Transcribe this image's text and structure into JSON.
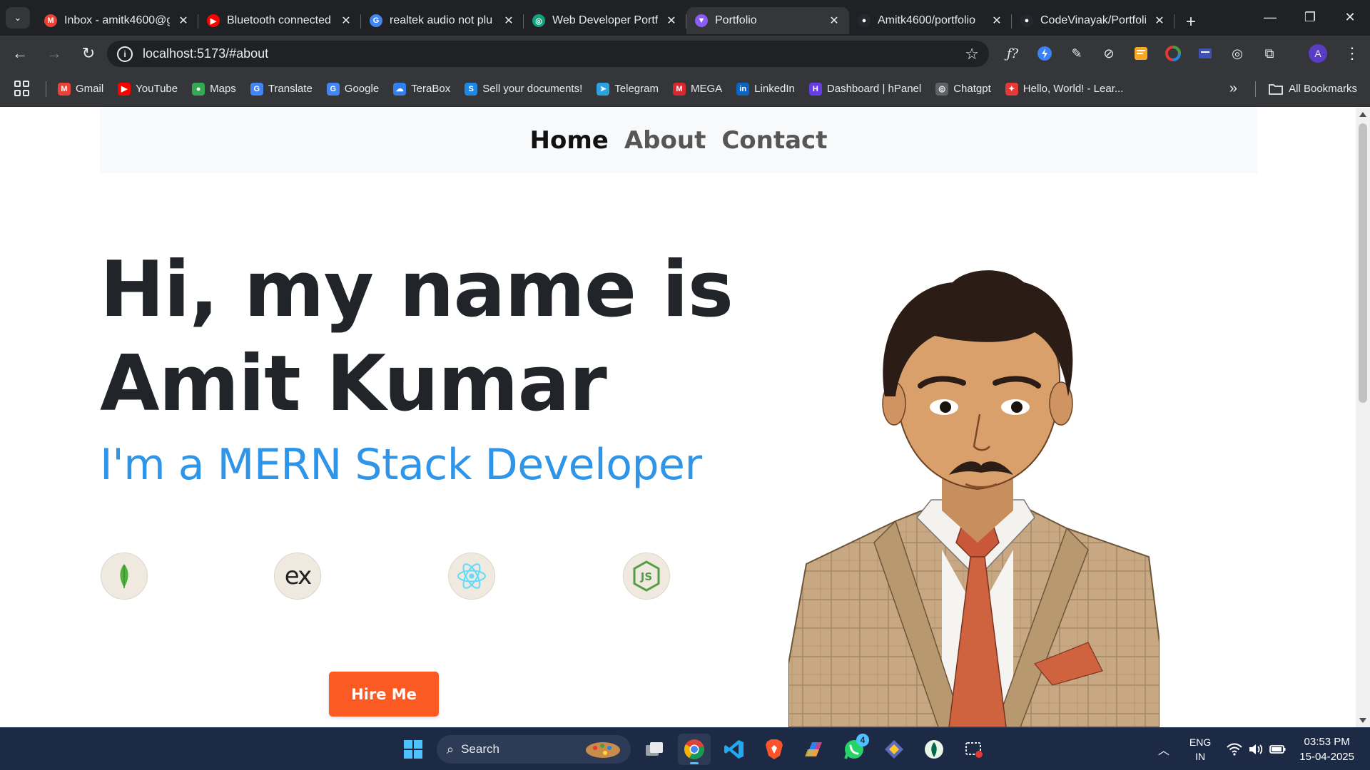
{
  "browser": {
    "tabs": [
      {
        "title": "Inbox - amitk4600@g",
        "icon": "gmail-icon",
        "color": "#ea4335",
        "glyph": "M",
        "active": false
      },
      {
        "title": "Bluetooth connected",
        "icon": "youtube-icon",
        "color": "#ff0000",
        "glyph": "▶",
        "active": false
      },
      {
        "title": "realtek audio not plu",
        "icon": "google-icon",
        "color": "#4285f4",
        "glyph": "G",
        "active": false
      },
      {
        "title": "Web Developer Portf",
        "icon": "chatgpt-icon",
        "color": "#10a37f",
        "glyph": "◎",
        "active": false
      },
      {
        "title": "Portfolio",
        "icon": "vite-icon",
        "color": "#8b5cf6",
        "glyph": "▼",
        "active": true
      },
      {
        "title": "Amitk4600/portfolio",
        "icon": "github-icon",
        "color": "#24292f",
        "glyph": "●",
        "active": false
      },
      {
        "title": "CodeVinayak/Portfoli",
        "icon": "github-icon",
        "color": "#24292f",
        "glyph": "●",
        "active": false
      }
    ],
    "address": "localhost:5173/#about",
    "profile_initial": "A",
    "bookmarks": [
      {
        "label": "Gmail",
        "icon": "gmail-icon",
        "color": "#ea4335",
        "glyph": "M"
      },
      {
        "label": "YouTube",
        "icon": "youtube-icon",
        "color": "#ff0000",
        "glyph": "▶"
      },
      {
        "label": "Maps",
        "icon": "maps-icon",
        "color": "#34a853",
        "glyph": "●"
      },
      {
        "label": "Translate",
        "icon": "translate-icon",
        "color": "#4285f4",
        "glyph": "G"
      },
      {
        "label": "Google",
        "icon": "google-icon",
        "color": "#4285f4",
        "glyph": "G"
      },
      {
        "label": "TeraBox",
        "icon": "terabox-icon",
        "color": "#2f80ed",
        "glyph": "☁"
      },
      {
        "label": "Sell your documents!",
        "icon": "sell-docs-icon",
        "color": "#1e88e5",
        "glyph": "S"
      },
      {
        "label": "Telegram",
        "icon": "telegram-icon",
        "color": "#2aa3e0",
        "glyph": "➤"
      },
      {
        "label": "MEGA",
        "icon": "mega-icon",
        "color": "#d9272e",
        "glyph": "M"
      },
      {
        "label": "LinkedIn",
        "icon": "linkedin-icon",
        "color": "#0a66c2",
        "glyph": "in"
      },
      {
        "label": "Dashboard | hPanel",
        "icon": "hostinger-icon",
        "color": "#673de6",
        "glyph": "H"
      },
      {
        "label": "Chatgpt",
        "icon": "chatgpt-icon",
        "color": "#5f6368",
        "glyph": "◎"
      },
      {
        "label": "Hello, World! - Lear...",
        "icon": "learn-icon",
        "color": "#e53935",
        "glyph": "✦"
      }
    ],
    "all_bookmarks": "All Bookmarks"
  },
  "site": {
    "nav": [
      {
        "label": "Home",
        "active": true
      },
      {
        "label": "About",
        "active": false
      },
      {
        "label": "Contact",
        "active": false
      }
    ],
    "hero": {
      "line1": "Hi, my name is",
      "line2": "Amit Kumar",
      "subtitle": "I'm a MERN Stack Developer"
    },
    "tech_icons": [
      "mongodb-icon",
      "express-icon",
      "react-icon",
      "nodejs-icon"
    ],
    "express_text": "ex",
    "node_text": "JS",
    "hire_label": "Hire Me",
    "colors": {
      "accent": "#2e95e8",
      "button": "#fb5a22",
      "heading": "#212529"
    }
  },
  "taskbar": {
    "search_placeholder": "Search",
    "whatsapp_badge": "4",
    "lang_top": "ENG",
    "lang_bottom": "IN",
    "time": "03:53 PM",
    "date": "15-04-2025"
  }
}
